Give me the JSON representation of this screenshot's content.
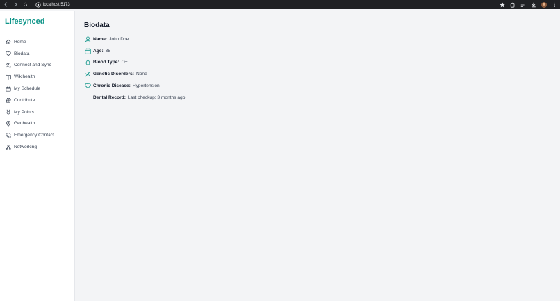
{
  "browser": {
    "url": "localhost:5173"
  },
  "brand": "Lifesynced",
  "sidebar": {
    "items": [
      {
        "label": "Home",
        "icon": "home-icon"
      },
      {
        "label": "Biodata",
        "icon": "heart-icon"
      },
      {
        "label": "Connect and Sync",
        "icon": "users-icon"
      },
      {
        "label": "Wikihealth",
        "icon": "book-icon"
      },
      {
        "label": "My Schedule",
        "icon": "calendar-icon"
      },
      {
        "label": "Contribute",
        "icon": "gift-icon"
      },
      {
        "label": "My Points",
        "icon": "medal-icon"
      },
      {
        "label": "Geohealth",
        "icon": "map-pin-icon"
      },
      {
        "label": "Emergency Contact",
        "icon": "phone-icon"
      },
      {
        "label": "Networking",
        "icon": "network-icon"
      }
    ]
  },
  "main": {
    "title": "Biodata",
    "fields": [
      {
        "key": "Name:",
        "value": "John Doe",
        "icon": "user-icon"
      },
      {
        "key": "Age:",
        "value": "35",
        "icon": "calendar-icon"
      },
      {
        "key": "Blood Type:",
        "value": "O+",
        "icon": "droplet-icon"
      },
      {
        "key": "Genetic Disorders:",
        "value": "None",
        "icon": "dna-icon"
      },
      {
        "key": "Chronic Disease:",
        "value": "Hypertension",
        "icon": "heart-icon"
      },
      {
        "key": "Dental Record:",
        "value": "Last checkup: 3 months ago",
        "icon": ""
      }
    ]
  },
  "colors": {
    "accent": "#0d9488",
    "sidebar_bg": "#ffffff",
    "main_bg": "#f3f4f6",
    "chrome_bg": "#202124"
  }
}
